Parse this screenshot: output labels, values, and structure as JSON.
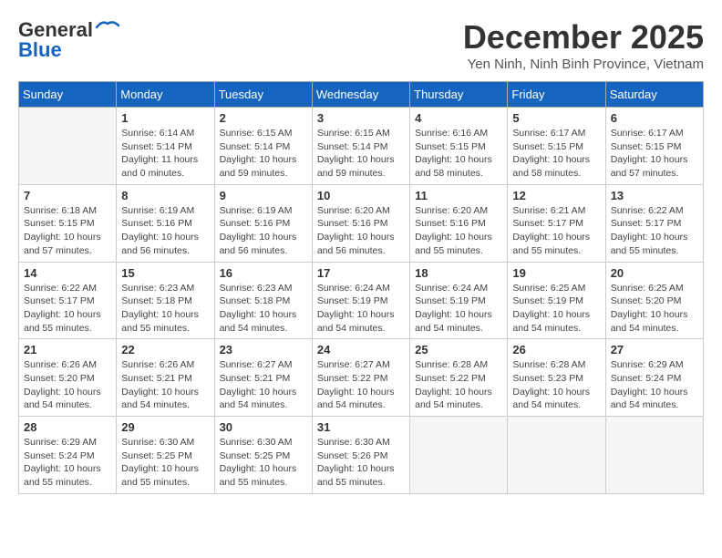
{
  "header": {
    "logo_general": "General",
    "logo_blue": "Blue",
    "month_title": "December 2025",
    "location": "Yen Ninh, Ninh Binh Province, Vietnam"
  },
  "weekdays": [
    "Sunday",
    "Monday",
    "Tuesday",
    "Wednesday",
    "Thursday",
    "Friday",
    "Saturday"
  ],
  "weeks": [
    [
      {
        "day": "",
        "empty": true
      },
      {
        "day": "1",
        "sunrise": "6:14 AM",
        "sunset": "5:14 PM",
        "daylight": "11 hours and 0 minutes."
      },
      {
        "day": "2",
        "sunrise": "6:15 AM",
        "sunset": "5:14 PM",
        "daylight": "10 hours and 59 minutes."
      },
      {
        "day": "3",
        "sunrise": "6:15 AM",
        "sunset": "5:14 PM",
        "daylight": "10 hours and 59 minutes."
      },
      {
        "day": "4",
        "sunrise": "6:16 AM",
        "sunset": "5:15 PM",
        "daylight": "10 hours and 58 minutes."
      },
      {
        "day": "5",
        "sunrise": "6:17 AM",
        "sunset": "5:15 PM",
        "daylight": "10 hours and 58 minutes."
      },
      {
        "day": "6",
        "sunrise": "6:17 AM",
        "sunset": "5:15 PM",
        "daylight": "10 hours and 57 minutes."
      }
    ],
    [
      {
        "day": "7",
        "sunrise": "6:18 AM",
        "sunset": "5:15 PM",
        "daylight": "10 hours and 57 minutes."
      },
      {
        "day": "8",
        "sunrise": "6:19 AM",
        "sunset": "5:16 PM",
        "daylight": "10 hours and 56 minutes."
      },
      {
        "day": "9",
        "sunrise": "6:19 AM",
        "sunset": "5:16 PM",
        "daylight": "10 hours and 56 minutes."
      },
      {
        "day": "10",
        "sunrise": "6:20 AM",
        "sunset": "5:16 PM",
        "daylight": "10 hours and 56 minutes."
      },
      {
        "day": "11",
        "sunrise": "6:20 AM",
        "sunset": "5:16 PM",
        "daylight": "10 hours and 55 minutes."
      },
      {
        "day": "12",
        "sunrise": "6:21 AM",
        "sunset": "5:17 PM",
        "daylight": "10 hours and 55 minutes."
      },
      {
        "day": "13",
        "sunrise": "6:22 AM",
        "sunset": "5:17 PM",
        "daylight": "10 hours and 55 minutes."
      }
    ],
    [
      {
        "day": "14",
        "sunrise": "6:22 AM",
        "sunset": "5:17 PM",
        "daylight": "10 hours and 55 minutes."
      },
      {
        "day": "15",
        "sunrise": "6:23 AM",
        "sunset": "5:18 PM",
        "daylight": "10 hours and 55 minutes."
      },
      {
        "day": "16",
        "sunrise": "6:23 AM",
        "sunset": "5:18 PM",
        "daylight": "10 hours and 54 minutes."
      },
      {
        "day": "17",
        "sunrise": "6:24 AM",
        "sunset": "5:19 PM",
        "daylight": "10 hours and 54 minutes."
      },
      {
        "day": "18",
        "sunrise": "6:24 AM",
        "sunset": "5:19 PM",
        "daylight": "10 hours and 54 minutes."
      },
      {
        "day": "19",
        "sunrise": "6:25 AM",
        "sunset": "5:19 PM",
        "daylight": "10 hours and 54 minutes."
      },
      {
        "day": "20",
        "sunrise": "6:25 AM",
        "sunset": "5:20 PM",
        "daylight": "10 hours and 54 minutes."
      }
    ],
    [
      {
        "day": "21",
        "sunrise": "6:26 AM",
        "sunset": "5:20 PM",
        "daylight": "10 hours and 54 minutes."
      },
      {
        "day": "22",
        "sunrise": "6:26 AM",
        "sunset": "5:21 PM",
        "daylight": "10 hours and 54 minutes."
      },
      {
        "day": "23",
        "sunrise": "6:27 AM",
        "sunset": "5:21 PM",
        "daylight": "10 hours and 54 minutes."
      },
      {
        "day": "24",
        "sunrise": "6:27 AM",
        "sunset": "5:22 PM",
        "daylight": "10 hours and 54 minutes."
      },
      {
        "day": "25",
        "sunrise": "6:28 AM",
        "sunset": "5:22 PM",
        "daylight": "10 hours and 54 minutes."
      },
      {
        "day": "26",
        "sunrise": "6:28 AM",
        "sunset": "5:23 PM",
        "daylight": "10 hours and 54 minutes."
      },
      {
        "day": "27",
        "sunrise": "6:29 AM",
        "sunset": "5:24 PM",
        "daylight": "10 hours and 54 minutes."
      }
    ],
    [
      {
        "day": "28",
        "sunrise": "6:29 AM",
        "sunset": "5:24 PM",
        "daylight": "10 hours and 55 minutes."
      },
      {
        "day": "29",
        "sunrise": "6:30 AM",
        "sunset": "5:25 PM",
        "daylight": "10 hours and 55 minutes."
      },
      {
        "day": "30",
        "sunrise": "6:30 AM",
        "sunset": "5:25 PM",
        "daylight": "10 hours and 55 minutes."
      },
      {
        "day": "31",
        "sunrise": "6:30 AM",
        "sunset": "5:26 PM",
        "daylight": "10 hours and 55 minutes."
      },
      {
        "day": "",
        "empty": true
      },
      {
        "day": "",
        "empty": true
      },
      {
        "day": "",
        "empty": true
      }
    ]
  ]
}
